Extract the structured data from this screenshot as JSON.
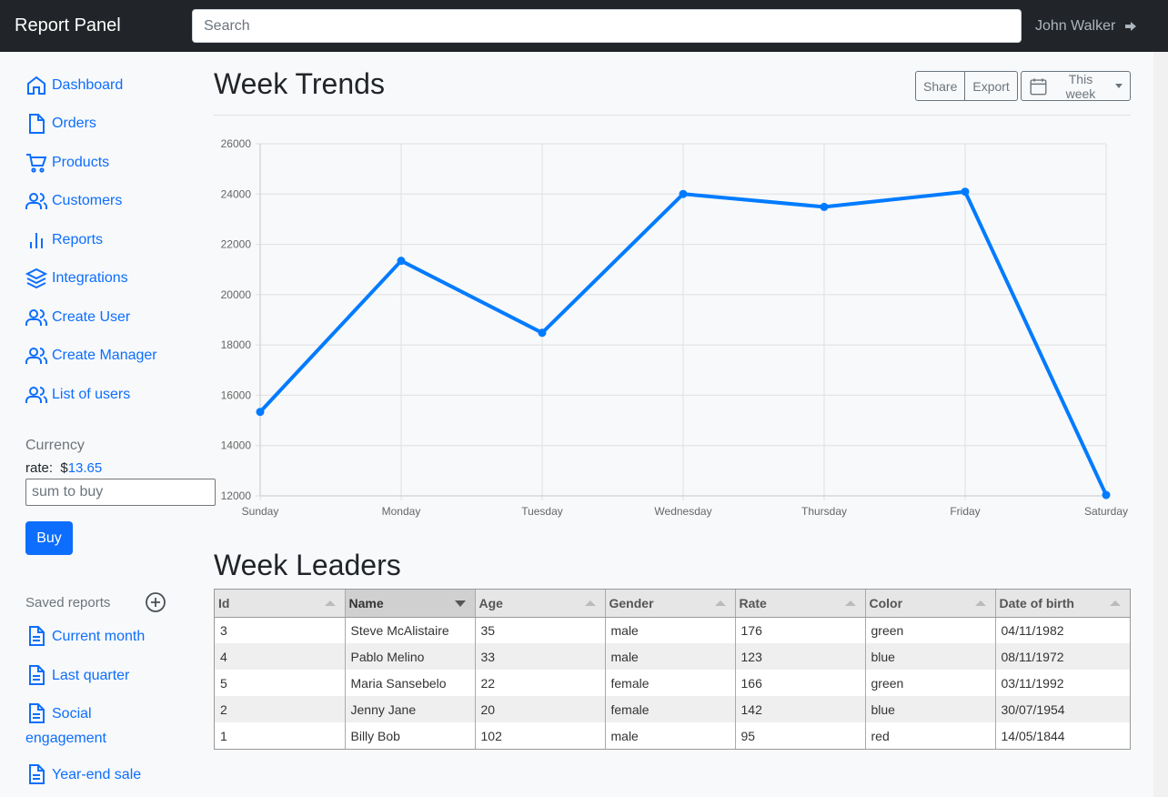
{
  "header": {
    "brand": "Report Panel",
    "search_placeholder": "Search",
    "user_name": "John Walker",
    "signout_icon": "sign-out-icon"
  },
  "sidebar": {
    "items": [
      {
        "label": "Dashboard",
        "icon": "home-icon"
      },
      {
        "label": "Orders",
        "icon": "file-icon"
      },
      {
        "label": "Products",
        "icon": "shopping-cart-icon"
      },
      {
        "label": "Customers",
        "icon": "users-icon"
      },
      {
        "label": "Reports",
        "icon": "bar-chart-icon"
      },
      {
        "label": "Integrations",
        "icon": "layers-icon"
      },
      {
        "label": "Create User",
        "icon": "users-icon"
      },
      {
        "label": "Create Manager",
        "icon": "users-icon"
      },
      {
        "label": "List of users",
        "icon": "users-icon"
      }
    ],
    "currency": {
      "heading": "Currency",
      "rate_label": "rate:",
      "rate_symbol": "$",
      "rate_value": "13.65",
      "input_placeholder": "sum to buy",
      "buy_label": "Buy"
    },
    "saved_reports": {
      "heading": "Saved reports",
      "items": [
        "Current month",
        "Last quarter",
        "Social engagement",
        "Year-end sale"
      ]
    }
  },
  "main": {
    "title": "Week Trends",
    "share_label": "Share",
    "export_label": "Export",
    "period_label": "This week",
    "table_title": "Week Leaders"
  },
  "colors": {
    "accent": "#0d6efd",
    "line": "#007bff",
    "topbar": "#212529"
  },
  "chart_data": {
    "type": "line",
    "categories": [
      "Sunday",
      "Monday",
      "Tuesday",
      "Wednesday",
      "Thursday",
      "Friday",
      "Saturday"
    ],
    "values": [
      15339,
      21345,
      18483,
      24003,
      23489,
      24092,
      12034
    ],
    "ylim": [
      12000,
      26000
    ],
    "yticks": [
      12000,
      14000,
      16000,
      18000,
      20000,
      22000,
      24000,
      26000
    ],
    "grid": true,
    "legend": "none"
  },
  "table": {
    "columns": [
      "Id",
      "Name",
      "Age",
      "Gender",
      "Rate",
      "Color",
      "Date of birth"
    ],
    "sorted_column": "Name",
    "rows": [
      [
        "3",
        "Steve McAlistaire",
        "35",
        "male",
        "176",
        "green",
        "04/11/1982"
      ],
      [
        "4",
        "Pablo Melino",
        "33",
        "male",
        "123",
        "blue",
        "08/11/1972"
      ],
      [
        "5",
        "Maria Sansebelo",
        "22",
        "female",
        "166",
        "green",
        "03/11/1992"
      ],
      [
        "2",
        "Jenny Jane",
        "20",
        "female",
        "142",
        "blue",
        "30/07/1954"
      ],
      [
        "1",
        "Billy Bob",
        "102",
        "male",
        "95",
        "red",
        "14/05/1844"
      ]
    ]
  }
}
